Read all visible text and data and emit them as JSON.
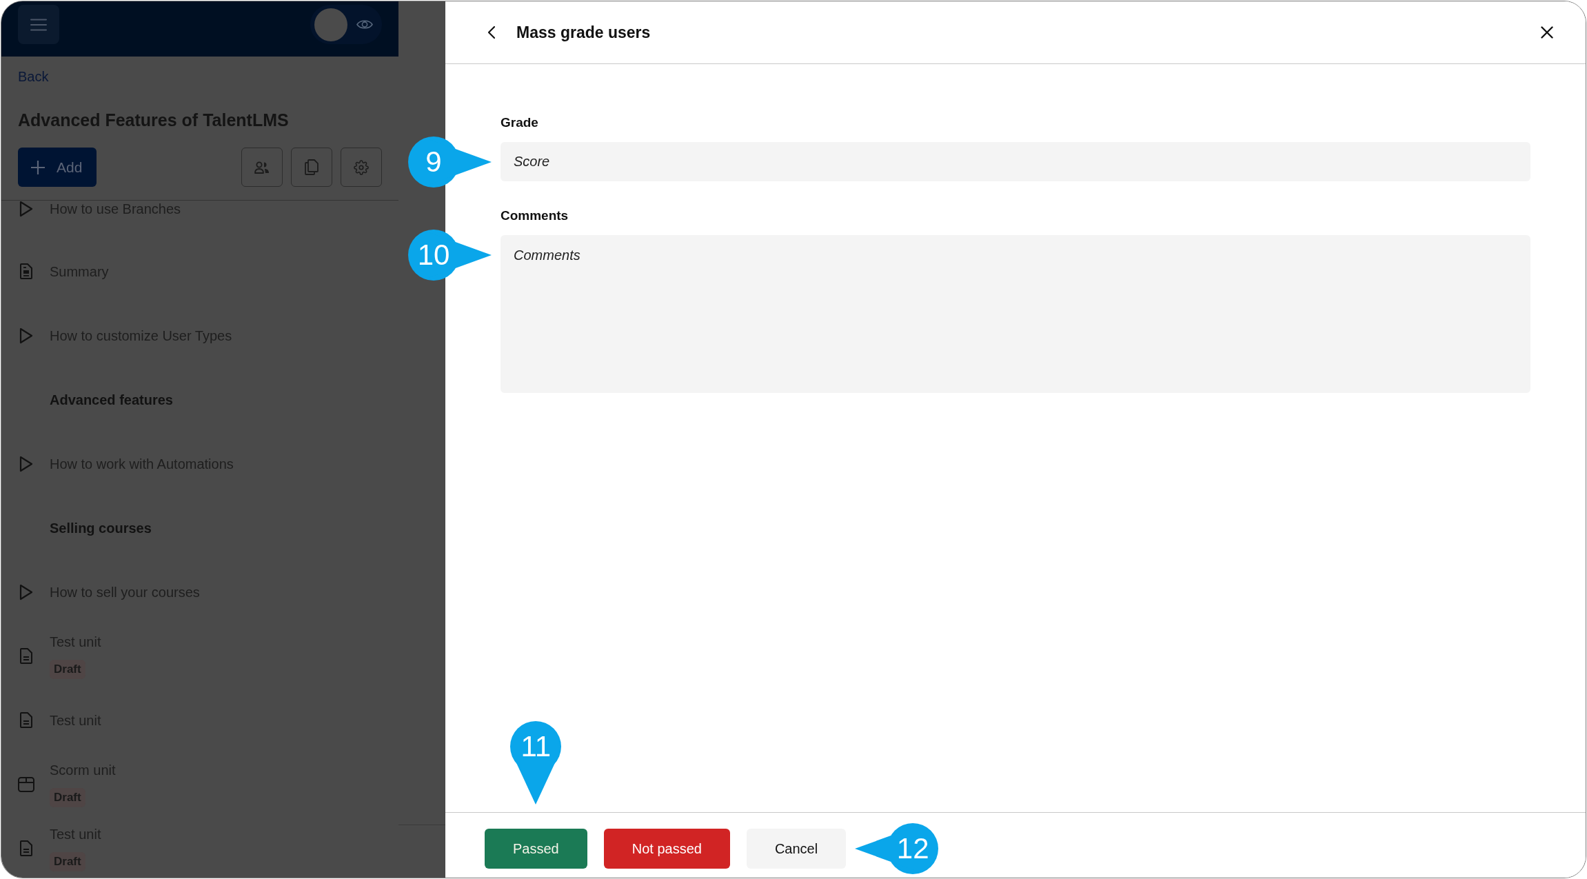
{
  "app": {
    "view_toggle": {
      "on": false
    },
    "back_link": "Back",
    "course_title": "Advanced Features of TalentLMS",
    "add_button": "Add",
    "units": [
      {
        "kind": "video",
        "title": "How to use Branches"
      },
      {
        "kind": "content",
        "title": "Summary"
      },
      {
        "kind": "video",
        "title": "How to customize User Types"
      },
      {
        "kind": "section",
        "title": "Advanced features"
      },
      {
        "kind": "video",
        "title": "How to work with Automations"
      },
      {
        "kind": "section",
        "title": "Selling courses"
      },
      {
        "kind": "video",
        "title": "How to sell your courses"
      },
      {
        "kind": "test",
        "title": "Test unit",
        "status": "Draft"
      },
      {
        "kind": "test",
        "title": "Test unit"
      },
      {
        "kind": "scorm",
        "title": "Scorm unit",
        "status": "Draft"
      },
      {
        "kind": "test",
        "title": "Test unit",
        "status": "Draft"
      }
    ]
  },
  "drawer": {
    "title": "Mass grade users",
    "fields": [
      {
        "kind": "input",
        "label": "Grade",
        "placeholder": "Score",
        "callout": {
          "label": "9",
          "kind": "pointright"
        }
      },
      {
        "kind": "textarea",
        "label": "Comments",
        "placeholder": "Comments",
        "callout": {
          "label": "10",
          "kind": "pointright"
        }
      }
    ],
    "buttons": [
      {
        "kind": "success",
        "label": "Passed",
        "callout": {
          "label": "11",
          "kind": "pointdown"
        }
      },
      {
        "kind": "danger",
        "label": "Not passed"
      },
      {
        "kind": "neutral",
        "label": "Cancel",
        "callout": {
          "label": "12",
          "kind": "pointleft"
        }
      }
    ]
  }
}
